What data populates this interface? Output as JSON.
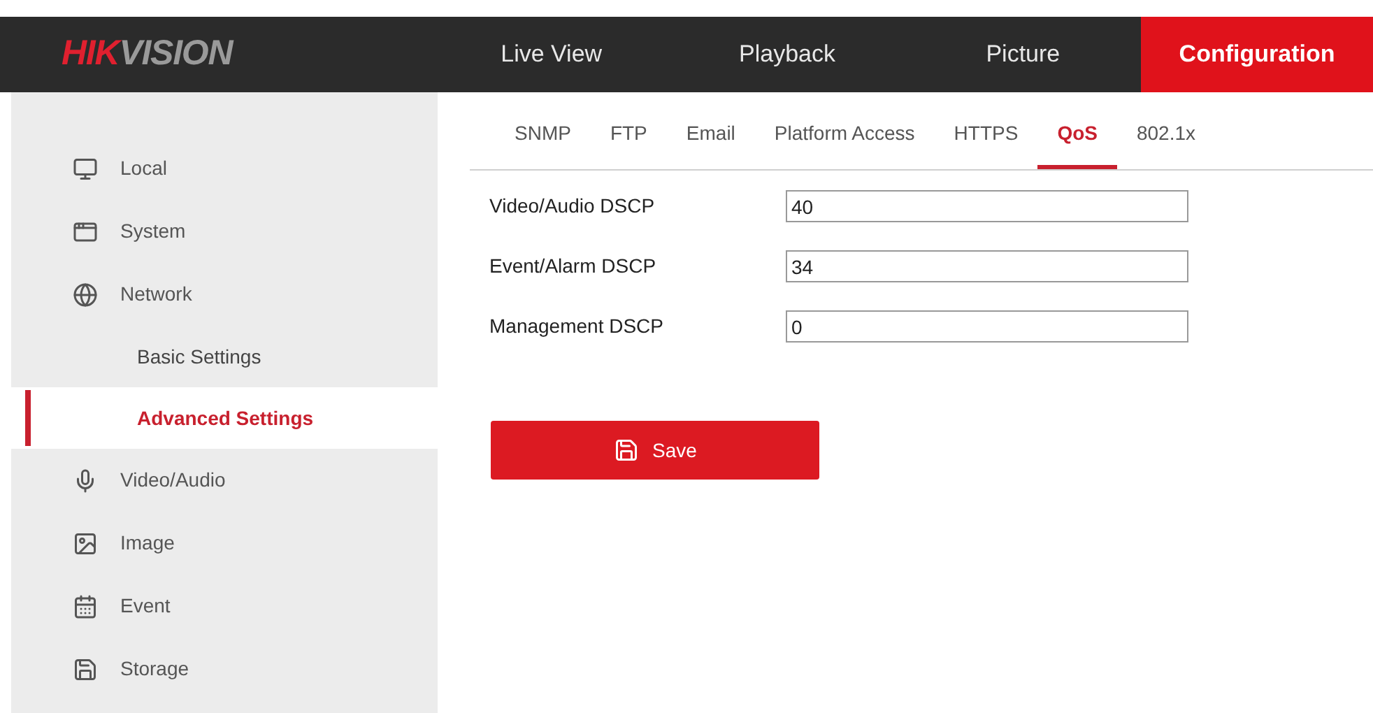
{
  "logo": [
    {
      "text": "HIK",
      "kind": "accent"
    },
    {
      "text": "VISION",
      "kind": "plain"
    }
  ],
  "nav": [
    {
      "label": "Live View",
      "selected": false
    },
    {
      "label": "Playback",
      "selected": false
    },
    {
      "label": "Picture",
      "selected": false
    },
    {
      "label": "Configuration",
      "selected": true
    }
  ],
  "sidebar": {
    "items": [
      {
        "label": "Local",
        "kind": "monitor",
        "selected": false
      },
      {
        "label": "System",
        "kind": "window",
        "selected": false
      },
      {
        "label": "Network",
        "kind": "globe",
        "selected": false,
        "children": [
          {
            "label": "Basic Settings",
            "selected": false
          },
          {
            "label": "Advanced Settings",
            "selected": true
          }
        ]
      },
      {
        "label": "Video/Audio",
        "kind": "mic",
        "selected": false
      },
      {
        "label": "Image",
        "kind": "image",
        "selected": false
      },
      {
        "label": "Event",
        "kind": "calendar",
        "selected": false
      },
      {
        "label": "Storage",
        "kind": "disk",
        "selected": false
      }
    ]
  },
  "tabs": [
    {
      "label": "SNMP",
      "selected": false
    },
    {
      "label": "FTP",
      "selected": false
    },
    {
      "label": "Email",
      "selected": false
    },
    {
      "label": "Platform Access",
      "selected": false
    },
    {
      "label": "HTTPS",
      "selected": false
    },
    {
      "label": "QoS",
      "selected": true
    },
    {
      "label": "802.1x",
      "selected": false
    }
  ],
  "fields": [
    {
      "label": "Video/Audio DSCP",
      "value": "40"
    },
    {
      "label": "Event/Alarm DSCP",
      "value": "34"
    },
    {
      "label": "Management DSCP",
      "value": "0"
    }
  ],
  "save_button": {
    "label": "Save"
  }
}
